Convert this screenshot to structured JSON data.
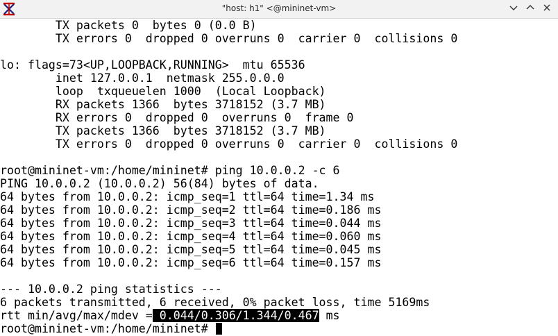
{
  "window": {
    "title": "\"host: h1\" <@mininet-vm>",
    "app_icon": "xterm-x-icon",
    "controls": [
      "chevron-down-icon",
      "chevron-up-icon",
      "close-icon"
    ]
  },
  "terminal": {
    "lines": [
      "        TX packets 0  bytes 0 (0.0 B)",
      "        TX errors 0  dropped 0 overruns 0  carrier 0  collisions 0",
      "",
      "lo: flags=73<UP,LOOPBACK,RUNNING>  mtu 65536",
      "        inet 127.0.0.1  netmask 255.0.0.0",
      "        loop  txqueuelen 1000  (Local Loopback)",
      "        RX packets 1366  bytes 3718152 (3.7 MB)",
      "        RX errors 0  dropped 0  overruns 0  frame 0",
      "        TX packets 1366  bytes 3718152 (3.7 MB)",
      "        TX errors 0  dropped 0 overruns 0  carrier 0  collisions 0",
      "",
      "root@mininet-vm:/home/mininet# ping 10.0.0.2 -c 6",
      "PING 10.0.0.2 (10.0.0.2) 56(84) bytes of data.",
      "64 bytes from 10.0.0.2: icmp_seq=1 ttl=64 time=1.34 ms",
      "64 bytes from 10.0.0.2: icmp_seq=2 ttl=64 time=0.186 ms",
      "64 bytes from 10.0.0.2: icmp_seq=3 ttl=64 time=0.044 ms",
      "64 bytes from 10.0.0.2: icmp_seq=4 ttl=64 time=0.060 ms",
      "64 bytes from 10.0.0.2: icmp_seq=5 ttl=64 time=0.045 ms",
      "64 bytes from 10.0.0.2: icmp_seq=6 ttl=64 time=0.157 ms",
      "",
      "--- 10.0.0.2 ping statistics ---",
      "6 packets transmitted, 6 received, 0% packet loss, time 5169ms"
    ],
    "rtt_line": {
      "prefix": "rtt min/avg/max/mdev =",
      "selected": " 0.044/0.306/1.344/0.467",
      "suffix": " ms"
    },
    "prompt": "root@mininet-vm:/home/mininet# "
  }
}
